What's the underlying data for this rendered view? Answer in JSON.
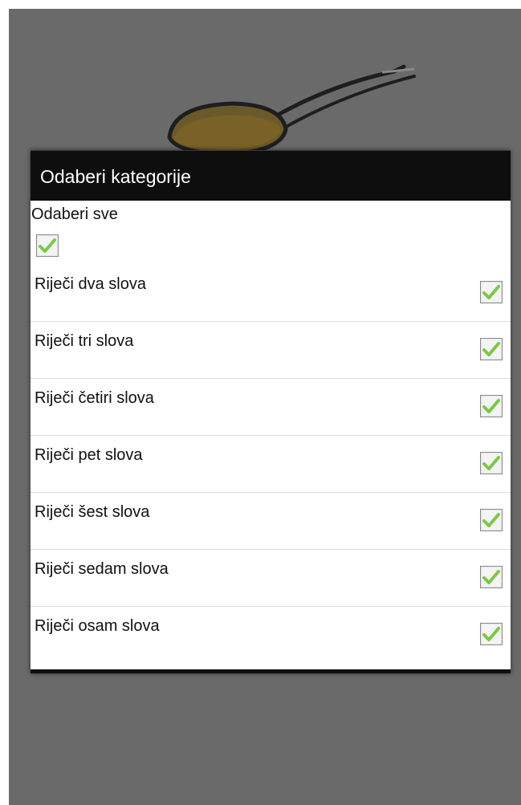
{
  "dialog": {
    "title": "Odaberi kategorije",
    "select_all": {
      "label": "Odaberi sve",
      "checked": true
    },
    "items": [
      {
        "label": "Riječi dva slova",
        "checked": true
      },
      {
        "label": "Riječi tri slova",
        "checked": true
      },
      {
        "label": "Riječi četiri slova",
        "checked": true
      },
      {
        "label": "Riječi pet slova",
        "checked": true
      },
      {
        "label": "Riječi šest slova",
        "checked": true
      },
      {
        "label": "Riječi sedam slova",
        "checked": true
      },
      {
        "label": "Riječi osam slova",
        "checked": true
      }
    ]
  },
  "colors": {
    "overlay": "#6a6a6a",
    "dialog_title_bg": "#0e0e0e",
    "checkmark": "#7ac943"
  },
  "icons": {
    "background_art": "honey-spoon-icon",
    "check": "checkmark-icon"
  }
}
